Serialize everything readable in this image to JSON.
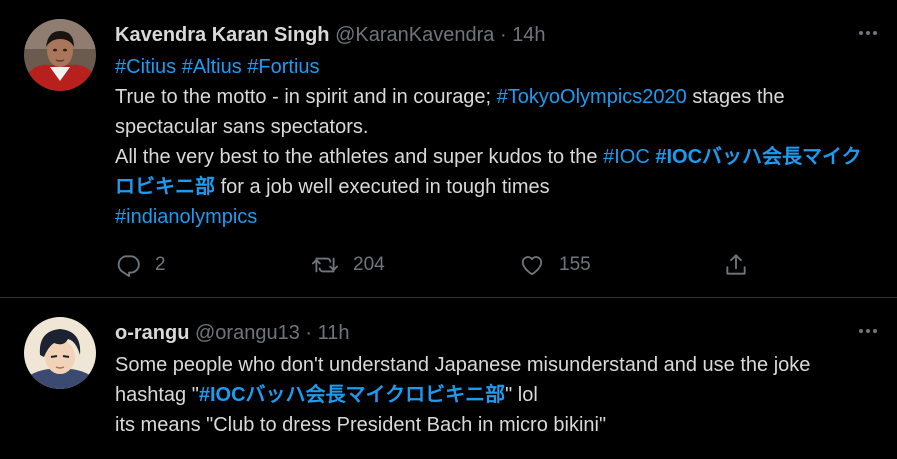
{
  "tweets": [
    {
      "author": {
        "name": "Kavendra Karan Singh",
        "handle": "@KaranKavendra",
        "sep": "·",
        "time": "14h"
      },
      "text": {
        "h_citius": "#Citius",
        "h_altius": "#Altius",
        "h_fortius": "#Fortius",
        "l2_a": "True to the motto - in spirit and in courage;",
        "h_tokyo": "#TokyoOlympics2020",
        "l2_b": "stages the spectacular sans spectators.",
        "l3_a": "All the very best to the athletes and super kudos to the",
        "h_ioc": "#IOC",
        "h_ioc_bach": "#IOCバッハ会長マイクロビキニ部",
        "l3_b": "for a job well executed in tough times",
        "h_indian": "#indianolympics"
      },
      "stats": {
        "replies": "2",
        "retweets": "204",
        "likes": "155"
      }
    },
    {
      "author": {
        "name": "o-rangu",
        "handle": "@orangu13",
        "sep": "·",
        "time": "11h"
      },
      "text": {
        "l1": "Some people who don't understand Japanese misunderstand and use the joke hashtag \"",
        "h_ioc_bach": "#IOCバッハ会長マイクロビキニ部",
        "l1_b": "\" lol",
        "l2": "its means \"Club to dress President Bach in micro bikini\""
      }
    }
  ],
  "colors": {
    "background": "#000000",
    "text": "#d9d9d9",
    "muted": "#6e767d",
    "link": "#1d9bf0",
    "divider": "#2f3336"
  },
  "icons": [
    "reply-icon",
    "retweet-icon",
    "like-icon",
    "share-icon",
    "more-icon"
  ]
}
